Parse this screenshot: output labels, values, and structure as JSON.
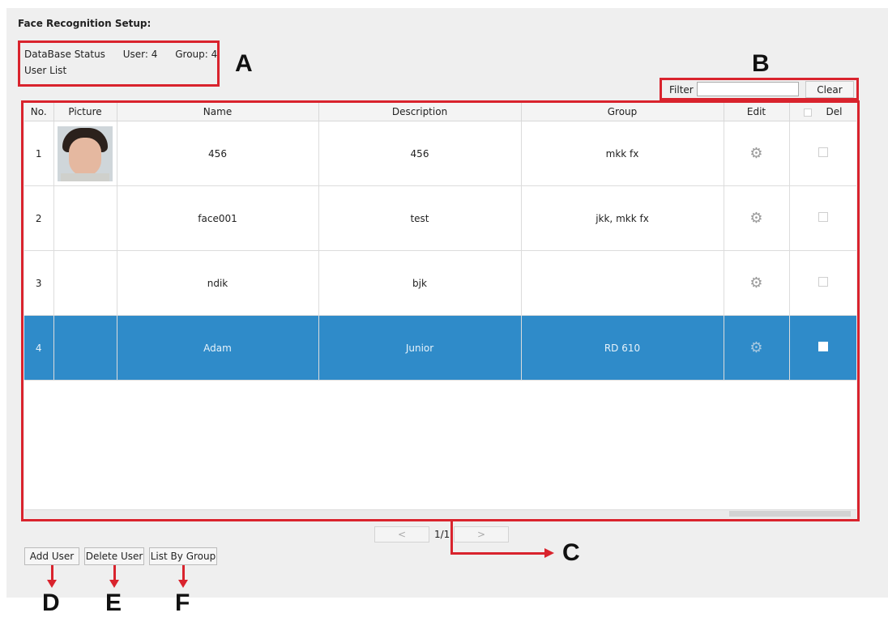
{
  "title": "Face Recognition Setup:",
  "status": {
    "label": "DataBase Status",
    "user": "User: 4",
    "group": "Group: 4"
  },
  "user_list_label": "User List",
  "filter": {
    "label": "Filter",
    "value": "",
    "clear_label": "Clear"
  },
  "table": {
    "headers": {
      "no": "No.",
      "picture": "Picture",
      "name": "Name",
      "description": "Description",
      "group": "Group",
      "edit": "Edit",
      "del": "Del"
    },
    "rows": [
      {
        "no": "1",
        "name": "456",
        "description": "456",
        "group": "mkk fx"
      },
      {
        "no": "2",
        "name": "face001",
        "description": "test",
        "group": "jkk,  mkk fx"
      },
      {
        "no": "3",
        "name": "ndik",
        "description": "bjk",
        "group": ""
      },
      {
        "no": "4",
        "name": "Adam",
        "description": "Junior",
        "group": "RD 610"
      }
    ]
  },
  "pager": {
    "prev": "<",
    "page": "1/1",
    "next": ">"
  },
  "buttons": {
    "add_user": "Add User",
    "delete_user": "Delete User",
    "list_by_group": "List By Group"
  },
  "callouts": {
    "a": "A",
    "b": "B",
    "c": "C",
    "d": "D",
    "e": "E",
    "f": "F"
  },
  "colors": {
    "selected_row": "#2f8bc9",
    "annotation_red": "#d9232d"
  }
}
